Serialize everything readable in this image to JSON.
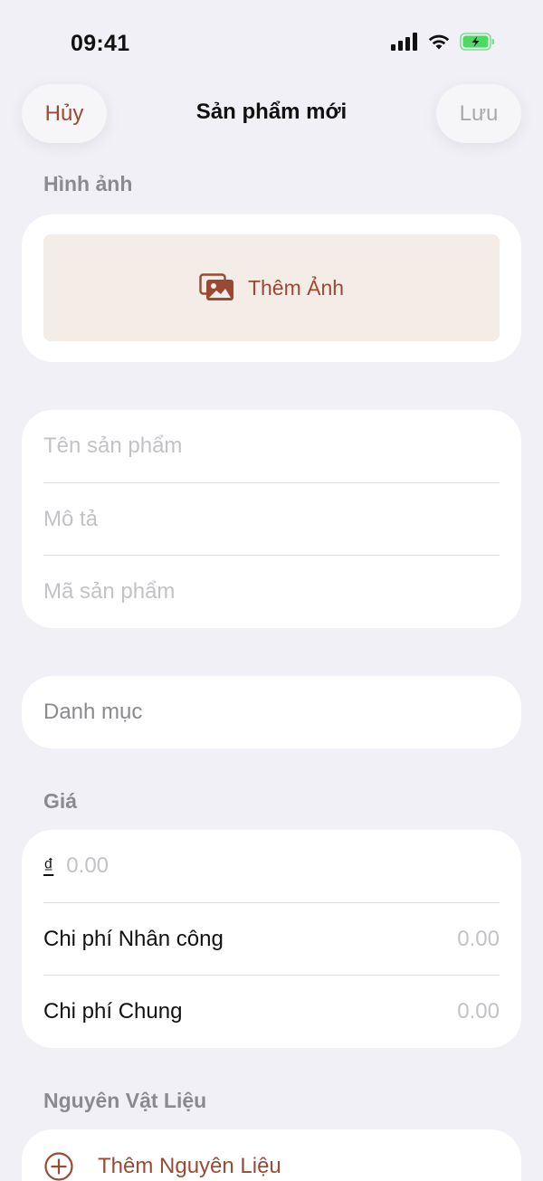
{
  "status_bar": {
    "time": "09:41",
    "icons": [
      "cellular-signal-icon",
      "wifi-icon",
      "battery-charging-icon"
    ],
    "battery_color": "#4cd964"
  },
  "nav": {
    "cancel_label": "Hủy",
    "title": "Sản phẩm mới",
    "save_label": "Lưu"
  },
  "images_section": {
    "label": "Hình ảnh",
    "add_photo_label": "Thêm Ảnh",
    "add_photo_icon": "photo-stack-icon"
  },
  "info_fields": {
    "name_placeholder": "Tên sản phẩm",
    "description_placeholder": "Mô tả",
    "code_placeholder": "Mã sản phẩm"
  },
  "category": {
    "placeholder": "Danh mục"
  },
  "price_section": {
    "label": "Giá",
    "currency_symbol": "₫",
    "price_placeholder": "0.00",
    "labor_cost_label": "Chi phí Nhân công",
    "labor_cost_value": "0.00",
    "overhead_cost_label": "Chi phí Chung",
    "overhead_cost_value": "0.00"
  },
  "materials_section": {
    "label": "Nguyên Vật Liệu",
    "add_material_label": "Thêm Nguyên Liệu",
    "add_icon": "plus-circle-icon"
  },
  "colors": {
    "accent": "#9a4a33",
    "background": "#f0f0f6",
    "card": "#ffffff",
    "photo_button_bg": "#f3ece7",
    "placeholder": "#c2c2c7",
    "section_label": "#8a8a8f"
  }
}
